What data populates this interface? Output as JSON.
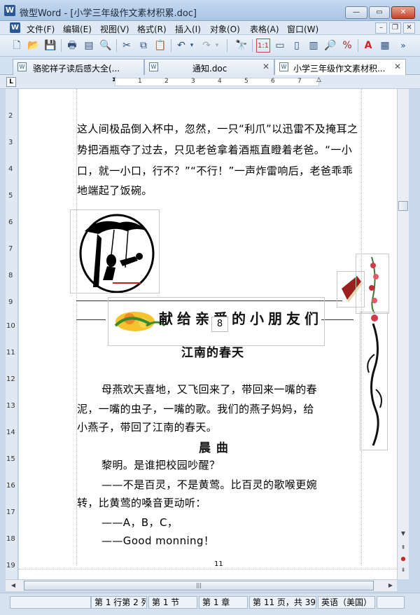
{
  "window": {
    "title": "微型Word - [小学三年级作文素材积累.doc]",
    "app_icon": "W"
  },
  "menu": {
    "doc_icon": "W",
    "items": [
      "文件(F)",
      "编辑(E)",
      "视图(V)",
      "格式(R)",
      "插入(I)",
      "对象(O)",
      "表格(A)",
      "窗口(W)"
    ]
  },
  "tabs": [
    {
      "label": "骆驼祥子读后感大全(...",
      "active": false
    },
    {
      "label": "通知.doc",
      "active": false
    },
    {
      "label": "小学三年级作文素材积...",
      "active": true
    }
  ],
  "ruler": {
    "corner": "L",
    "numbers": [
      "1",
      "2",
      "3",
      "4",
      "5",
      "6",
      "7"
    ]
  },
  "vruler": [
    "2",
    "3",
    "4",
    "5",
    "6",
    "7",
    "8",
    "9",
    "10",
    "11",
    "12",
    "13",
    "14",
    "15",
    "16",
    "17",
    "18",
    "19"
  ],
  "document": {
    "para1": [
      "这人间极品倒入杯中，忽然，一只“利爪”以迅雷不及掩耳之",
      "势把酒瓶夺了过去，只见老爸拿着酒瓶直瞪着老爸。“一小",
      "口，就一小口，行不？”“不行！”一声炸雷响后，老爸乖乖",
      "地端起了饭碗。"
    ],
    "banner_text": "献给亲爱的小朋友们",
    "page_badge": "8",
    "title1": "江南的春天",
    "para2": [
      "母燕欢天喜地，又飞回来了，带回来一嘴的春",
      "泥，一嘴的虫子，一嘴的歌。我们的燕子妈妈，给",
      "小燕子，带回了江南的春天。"
    ],
    "title2": "晨 曲",
    "para3": [
      "黎明。是谁把校园吵醒？",
      "——不是百灵，不是黄莺。比百灵的歌喉更婉",
      "转，比黄莺的嗓音更动听：",
      "——A，B，C，",
      "——Good  monning！"
    ],
    "footer_page": "11"
  },
  "status": {
    "position": "第 1 行第 2 列",
    "section": "第 1 节",
    "chapter": "第 1 章",
    "page": "第 11 页，共 39",
    "language": "英语（美国）"
  }
}
